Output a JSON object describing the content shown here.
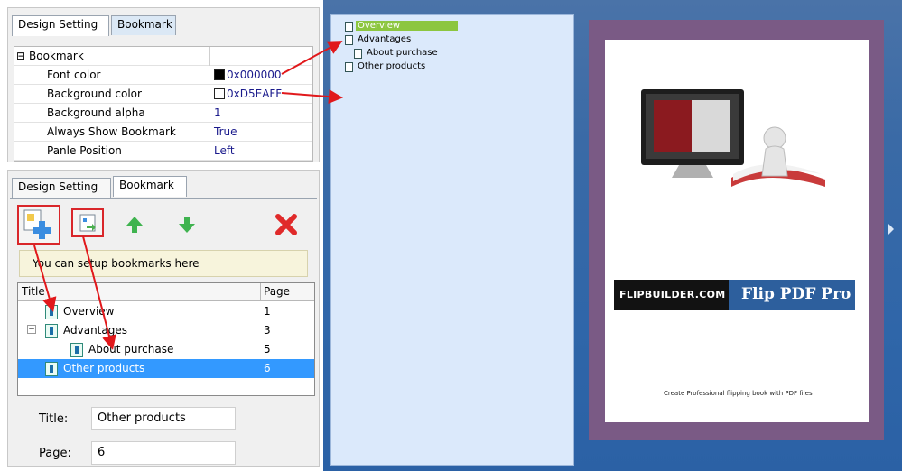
{
  "top_panel": {
    "tabs": [
      "Design Setting",
      "Bookmark"
    ],
    "group_label": "Bookmark",
    "group_toggle": "⊟",
    "properties": [
      {
        "name": "Font color",
        "value": "0x000000",
        "swatch": "#000000"
      },
      {
        "name": "Background color",
        "value": "0xD5EAFF",
        "swatch": "#ffffff"
      },
      {
        "name": "Background alpha",
        "value": "1"
      },
      {
        "name": "Always Show Bookmark",
        "value": "True"
      },
      {
        "name": "Panle Position",
        "value": "Left"
      }
    ]
  },
  "bottom_panel": {
    "tabs": [
      "Design Setting",
      "Bookmark"
    ],
    "hint": "You can setup bookmarks here",
    "columns": [
      "Title",
      "Page"
    ],
    "bookmarks": [
      {
        "title": "Overview",
        "page": "1"
      },
      {
        "title": "Advantages",
        "page": "3"
      },
      {
        "title": "About purchase",
        "page": "5"
      },
      {
        "title": "Other products",
        "page": "6"
      }
    ],
    "title_label": "Title:",
    "title_value": "Other products",
    "page_label": "Page:",
    "page_value": "6"
  },
  "preview": {
    "tree": [
      "Overview",
      "Advantages",
      "About purchase",
      "Other products"
    ],
    "banner_left": "FLIPBUILDER.COM",
    "banner_right": "Flip PDF Pro",
    "tagline": "Create Professional flipping book with PDF files"
  },
  "colors": {
    "accent_red": "#e1181b",
    "selection": "#3399ff",
    "preview_bg": "#2f66a9"
  }
}
